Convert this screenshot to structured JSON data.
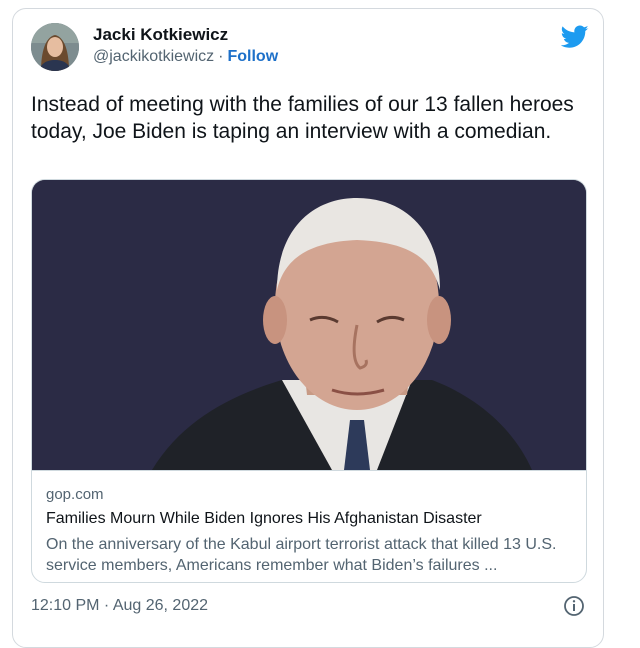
{
  "tweet": {
    "author": {
      "display_name": "Jacki Kotkiewicz",
      "handle": "@jackikotkiewicz",
      "separator": "·",
      "follow_label": "Follow"
    },
    "text": "Instead of meeting with the families of our 13 fallen heroes today, Joe Biden is taping an interview with a comedian.",
    "link_card": {
      "domain": "gop.com",
      "title": "Families Mourn While Biden Ignores His Afghanistan Disaster",
      "description": "On the anniversary of the Kabul airport terrorist attack that killed 13 U.S. service members, Americans remember what Biden’s failures ..."
    },
    "timestamp": "12:10 PM · Aug 26, 2022",
    "icons": {
      "brand": "twitter-bird-icon",
      "info": "info-icon"
    },
    "colors": {
      "brand": "#1d9bf0",
      "follow": "#1d70c9",
      "image_background": "#2b2b45"
    }
  }
}
